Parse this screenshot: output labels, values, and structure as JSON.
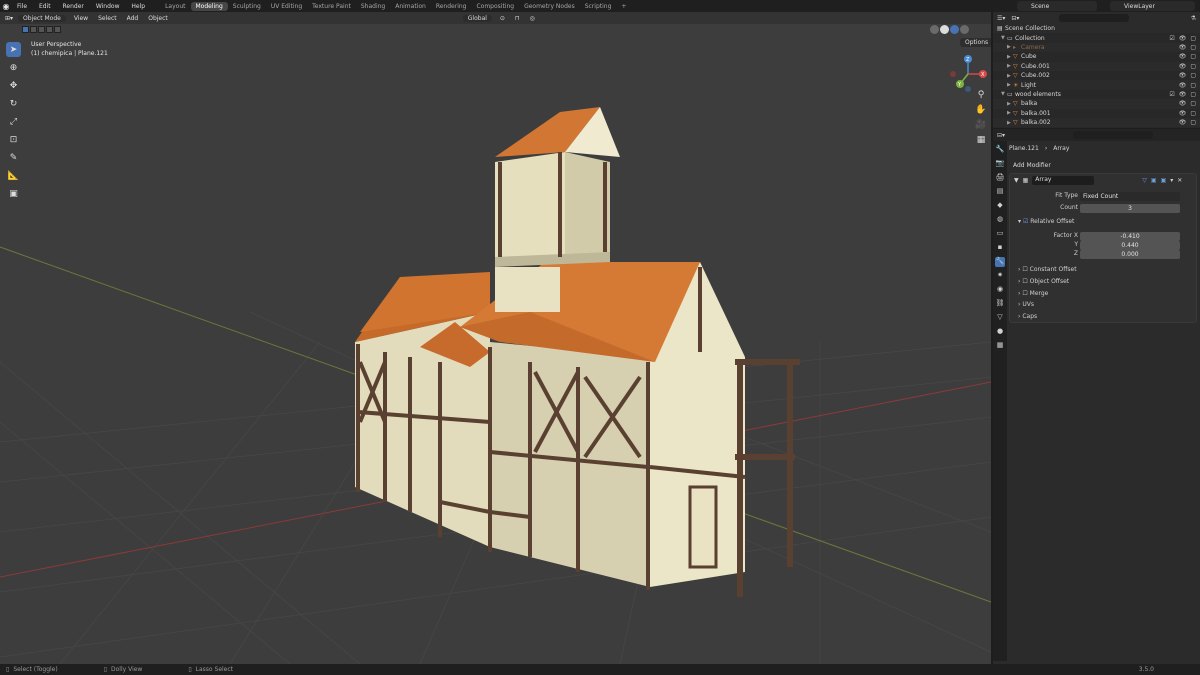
{
  "topbar": {
    "menu": [
      "File",
      "Edit",
      "Render",
      "Window",
      "Help"
    ],
    "workspaces": [
      "Layout",
      "Modeling",
      "Sculpting",
      "UV Editing",
      "Texture Paint",
      "Shading",
      "Animation",
      "Rendering",
      "Compositing",
      "Geometry Nodes",
      "Scripting",
      "+"
    ],
    "active_workspace": "Modeling",
    "scene": "Scene",
    "view_layer": "ViewLayer"
  },
  "viewport": {
    "mode": "Object Mode",
    "menus": [
      "View",
      "Select",
      "Add",
      "Object"
    ],
    "orientation": "Global",
    "perspective": "User Perspective",
    "object_info": "(1) chemipica | Plane.121",
    "options_label": "Options",
    "gizmo": {
      "x": "X",
      "y": "Y",
      "z": "Z"
    }
  },
  "outliner": {
    "rows": [
      {
        "name": "Scene Collection",
        "depth": 0,
        "icon": "scene-collection-icon"
      },
      {
        "name": "Collection",
        "depth": 1,
        "icon": "collection-icon"
      },
      {
        "name": "Camera",
        "depth": 2,
        "icon": "camera-icon",
        "dim": true
      },
      {
        "name": "Cube",
        "depth": 2,
        "icon": "mesh-icon"
      },
      {
        "name": "Cube.001",
        "depth": 2,
        "icon": "mesh-icon"
      },
      {
        "name": "Cube.002",
        "depth": 2,
        "icon": "mesh-icon"
      },
      {
        "name": "Light",
        "depth": 2,
        "icon": "light-icon"
      },
      {
        "name": "wood elements",
        "depth": 1,
        "icon": "collection-icon"
      },
      {
        "name": "balka",
        "depth": 2,
        "icon": "mesh-icon"
      },
      {
        "name": "balka.001",
        "depth": 2,
        "icon": "mesh-icon"
      },
      {
        "name": "balka.002",
        "depth": 2,
        "icon": "mesh-icon"
      }
    ]
  },
  "properties": {
    "object": "Plane.121",
    "modifier_crumb": "Array",
    "add_modifier": "Add Modifier",
    "modifier_name": "Array",
    "fit_type_label": "Fit Type",
    "fit_type": "Fixed Count",
    "count_label": "Count",
    "count": "3",
    "relative_offset": "Relative Offset",
    "factor_x_label": "Factor X",
    "factor_x": "-0.410",
    "y_label": "Y",
    "factor_y": "0.440",
    "z_label": "Z",
    "factor_z": "0.000",
    "sections": [
      "Constant Offset",
      "Object Offset",
      "Merge",
      "UVs",
      "Caps"
    ]
  },
  "statusbar": {
    "items": [
      "Select (Toggle)",
      "Dolly View",
      "Lasso Select"
    ],
    "version": "3.5.0"
  }
}
